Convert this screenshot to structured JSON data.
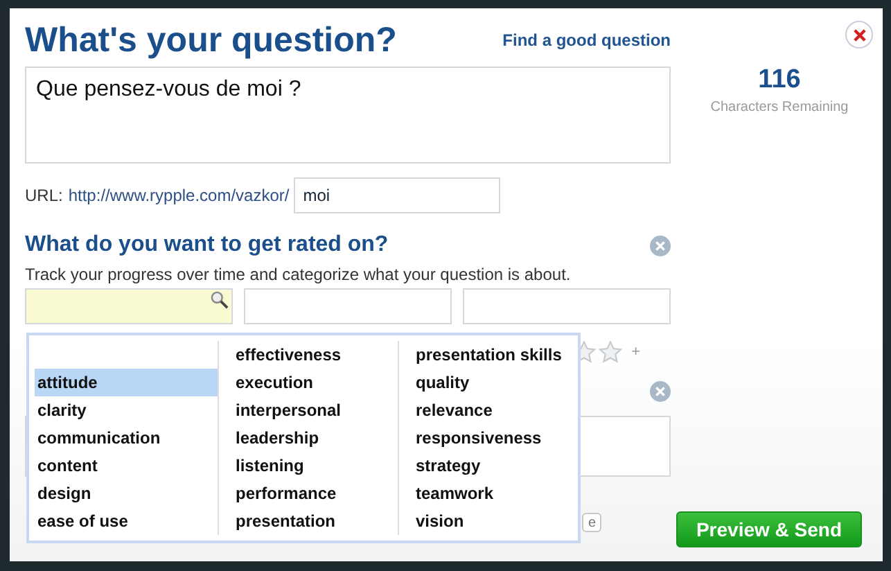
{
  "title": "What's your question?",
  "help_link": "Find a good question",
  "question": {
    "value": "Que pensez-vous de moi ?"
  },
  "counter": {
    "count": "116",
    "label": "Characters Remaining"
  },
  "url": {
    "label": "URL:",
    "base": "http://www.rypple.com/vazkor/",
    "value": "moi"
  },
  "rating": {
    "heading": "What do you want to get rated on?",
    "description": "Track your progress over time and categorize what your question is about.",
    "fields": [
      {
        "active": true
      },
      {
        "active": false
      },
      {
        "active": false
      }
    ],
    "plus": "+",
    "hidden_button": "e"
  },
  "dropdown": {
    "columns": [
      [
        {
          "label": "attitude",
          "selected": true
        },
        {
          "label": "clarity",
          "selected": false
        },
        {
          "label": "communication",
          "selected": false
        },
        {
          "label": "content",
          "selected": false
        },
        {
          "label": "design",
          "selected": false
        },
        {
          "label": "ease of use",
          "selected": false
        }
      ],
      [
        {
          "label": "effectiveness",
          "selected": false
        },
        {
          "label": "execution",
          "selected": false
        },
        {
          "label": "interpersonal",
          "selected": false
        },
        {
          "label": "leadership",
          "selected": false
        },
        {
          "label": "listening",
          "selected": false
        },
        {
          "label": "performance",
          "selected": false
        },
        {
          "label": "presentation",
          "selected": false
        }
      ],
      [
        {
          "label": "presentation skills",
          "selected": false
        },
        {
          "label": "quality",
          "selected": false
        },
        {
          "label": "relevance",
          "selected": false
        },
        {
          "label": "responsiveness",
          "selected": false
        },
        {
          "label": "strategy",
          "selected": false
        },
        {
          "label": "teamwork",
          "selected": false
        },
        {
          "label": "vision",
          "selected": false
        }
      ]
    ]
  },
  "submit": "Preview & Send"
}
